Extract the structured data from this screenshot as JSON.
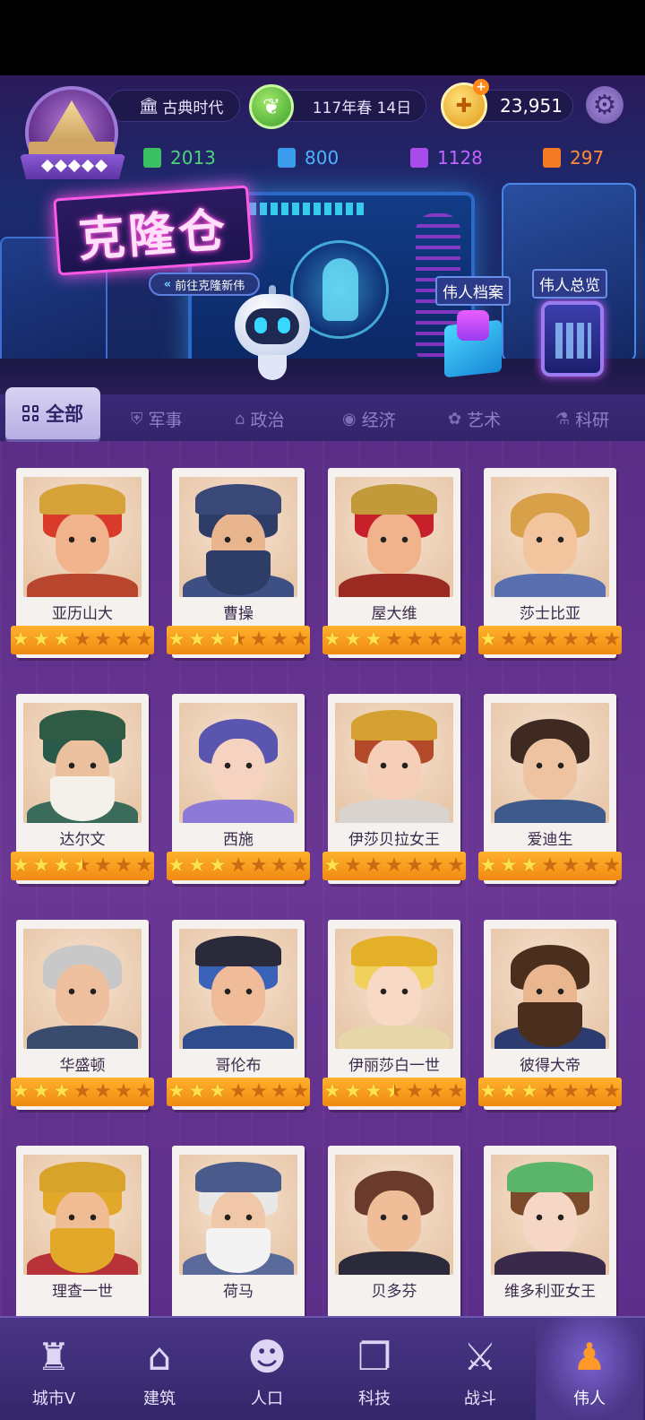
{
  "header": {
    "era": "古典时代",
    "date": "117年春 14日",
    "gold": "23,951",
    "resources": [
      {
        "value": "2013",
        "color": "#4bd47a"
      },
      {
        "value": "800",
        "color": "#4ab3ff"
      },
      {
        "value": "1128",
        "color": "#c164ff"
      },
      {
        "value": "297",
        "color": "#ff8c3a"
      }
    ]
  },
  "banner": {
    "title": "克隆仓",
    "subtitle": "前往克隆新伟",
    "archive_label": "伟人档案",
    "overview_label": "伟人总览"
  },
  "tabs": {
    "active": "全部",
    "items": [
      "军事",
      "政治",
      "经济",
      "艺术",
      "科研"
    ]
  },
  "heroes": [
    {
      "name": "亚历山大",
      "stars": 3
    },
    {
      "name": "曹操",
      "stars": 3.5
    },
    {
      "name": "屋大维",
      "stars": 3
    },
    {
      "name": "莎士比亚",
      "stars": 1
    },
    {
      "name": "达尔文",
      "stars": 3.5
    },
    {
      "name": "西施",
      "stars": 3
    },
    {
      "name": "伊莎贝拉女王",
      "stars": 1
    },
    {
      "name": "爱迪生",
      "stars": 3
    },
    {
      "name": "华盛顿",
      "stars": 3
    },
    {
      "name": "哥伦布",
      "stars": 3
    },
    {
      "name": "伊丽莎白一世",
      "stars": 3.5
    },
    {
      "name": "彼得大帝",
      "stars": 3
    },
    {
      "name": "理查一世",
      "stars": 0
    },
    {
      "name": "荷马",
      "stars": 0
    },
    {
      "name": "贝多芬",
      "stars": 0
    },
    {
      "name": "维多利亚女王",
      "stars": 0
    }
  ],
  "bottom_nav": [
    {
      "label": "城市V",
      "icon": "castle-icon"
    },
    {
      "label": "建筑",
      "icon": "house-icon"
    },
    {
      "label": "人口",
      "icon": "person-icon"
    },
    {
      "label": "科技",
      "icon": "book-icon"
    },
    {
      "label": "战斗",
      "icon": "swords-icon"
    },
    {
      "label": "伟人",
      "icon": "statue-icon"
    }
  ]
}
